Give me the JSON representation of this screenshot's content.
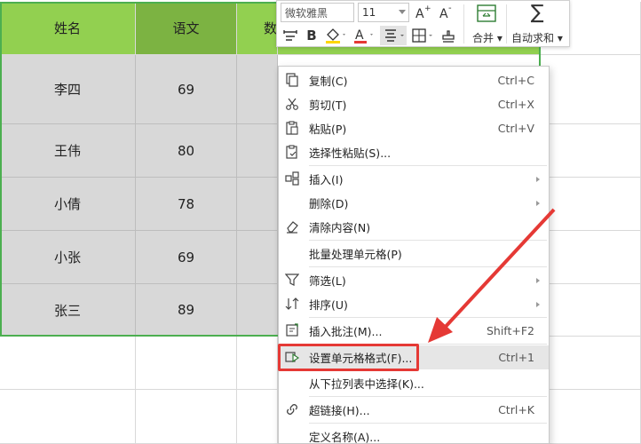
{
  "sheet": {
    "headers": [
      "姓名",
      "语文",
      "数"
    ],
    "rows": [
      [
        "李四",
        "69"
      ],
      [
        "王伟",
        "80"
      ],
      [
        "小倩",
        "78"
      ],
      [
        "小张",
        "69"
      ],
      [
        "张三",
        "89"
      ]
    ]
  },
  "minibar": {
    "font_name": "微软雅黑",
    "font_size": "11",
    "merge_label": "合并",
    "autosum_label": "自动求和"
  },
  "menu": {
    "items": [
      {
        "label": "复制(C)",
        "shortcut": "Ctrl+C",
        "icon": "copy-icon"
      },
      {
        "label": "剪切(T)",
        "shortcut": "Ctrl+X",
        "icon": "scissors-icon"
      },
      {
        "label": "粘贴(P)",
        "shortcut": "Ctrl+V",
        "icon": "paste-icon"
      },
      {
        "label": "选择性粘贴(S)...",
        "shortcut": "",
        "icon": "paste-special-icon"
      },
      {
        "label": "插入(I)",
        "shortcut": "",
        "icon": "insert-icon"
      },
      {
        "label": "删除(D)",
        "shortcut": "",
        "icon": ""
      },
      {
        "label": "清除内容(N)",
        "shortcut": "",
        "icon": "eraser-icon"
      },
      {
        "label": "批量处理单元格(P)",
        "shortcut": "",
        "icon": ""
      },
      {
        "label": "筛选(L)",
        "shortcut": "",
        "icon": "filter-icon"
      },
      {
        "label": "排序(U)",
        "shortcut": "",
        "icon": "sort-icon"
      },
      {
        "label": "插入批注(M)...",
        "shortcut": "Shift+F2",
        "icon": "comment-icon"
      },
      {
        "label": "设置单元格格式(F)...",
        "shortcut": "Ctrl+1",
        "icon": "format-cells-icon"
      },
      {
        "label": "从下拉列表中选择(K)...",
        "shortcut": "",
        "icon": ""
      },
      {
        "label": "超链接(H)...",
        "shortcut": "Ctrl+K",
        "icon": "link-icon"
      },
      {
        "label": "定义名称(A)...",
        "shortcut": "",
        "icon": ""
      }
    ]
  },
  "colors": {
    "header_green": "#92d050",
    "header_green_dark": "#7cb342",
    "data_gray": "#d8d8d8",
    "selection_green": "#4caf50",
    "annotation_red": "#e53935"
  }
}
